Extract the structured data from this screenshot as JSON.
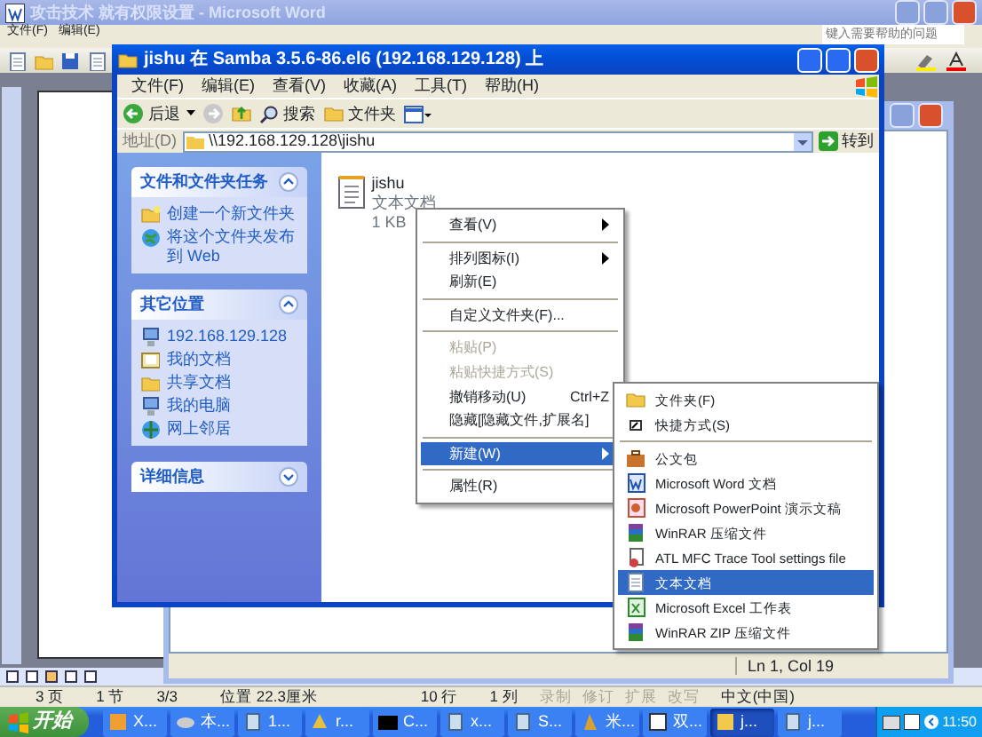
{
  "word": {
    "title": "攻击技术 就有权限设置 - Microsoft Word",
    "menus": [
      "文件(F)",
      "编辑(E)"
    ],
    "help_placeholder": "键入需要帮助的问题",
    "status_bar": [
      "3 页",
      "1 节",
      "3/3",
      "位置 22.3厘米",
      "10 行",
      "1 列"
    ],
    "status_flags": [
      {
        "label": "录制",
        "on": false
      },
      {
        "label": "修订",
        "on": false
      },
      {
        "label": "扩展",
        "on": false
      },
      {
        "label": "改写",
        "on": false
      }
    ],
    "language": "中文(中国)"
  },
  "notepad": {
    "status": "Ln 1, Col 19"
  },
  "explorer": {
    "title": "jishu 在 Samba 3.5.6-86.el6 (192.168.129.128) 上",
    "menus": [
      "文件(F)",
      "编辑(E)",
      "查看(V)",
      "收藏(A)",
      "工具(T)",
      "帮助(H)"
    ],
    "back": "后退",
    "search": "搜索",
    "folders": "文件夹",
    "address_label": "地址(D)",
    "address": "\\\\192.168.129.128\\jishu",
    "go": "转到",
    "panels": [
      {
        "title": "文件和文件夹任务",
        "expanded": true,
        "items": [
          {
            "kind": "new-folder",
            "label": "创建一个新文件夹"
          },
          {
            "kind": "web",
            "label": "将这个文件夹发布到 Web"
          }
        ]
      },
      {
        "title": "其它位置",
        "expanded": true,
        "items": [
          {
            "kind": "computer",
            "label": "192.168.129.128"
          },
          {
            "kind": "documents",
            "label": "我的文档"
          },
          {
            "kind": "folder",
            "label": "共享文档"
          },
          {
            "kind": "computer",
            "label": "我的电脑"
          },
          {
            "kind": "network",
            "label": "网上邻居"
          }
        ]
      },
      {
        "title": "详细信息",
        "expanded": false
      }
    ],
    "file": {
      "name": "jishu",
      "type": "文本文档",
      "size": "1 KB"
    }
  },
  "context_menu": [
    {
      "kind": "item",
      "label": "查看(V)",
      "submenu": true,
      "disabled": false,
      "selected": false
    },
    {
      "kind": "separator"
    },
    {
      "kind": "item",
      "label": "排列图标(I)",
      "submenu": true,
      "disabled": false,
      "selected": false
    },
    {
      "kind": "item",
      "label": "刷新(E)",
      "submenu": false,
      "disabled": false,
      "selected": false
    },
    {
      "kind": "separator"
    },
    {
      "kind": "item",
      "label": "自定义文件夹(F)...",
      "submenu": false,
      "disabled": false,
      "selected": false
    },
    {
      "kind": "separator"
    },
    {
      "kind": "item",
      "label": "粘贴(P)",
      "submenu": false,
      "disabled": true,
      "selected": false
    },
    {
      "kind": "item",
      "label": "粘贴快捷方式(S)",
      "submenu": false,
      "disabled": true,
      "selected": false
    },
    {
      "kind": "item",
      "label": "撤销移动(U)",
      "shortcut": "Ctrl+Z",
      "submenu": false,
      "disabled": false,
      "selected": false
    },
    {
      "kind": "item",
      "label": "隐藏[隐藏文件,扩展名]",
      "submenu": false,
      "disabled": false,
      "selected": false
    },
    {
      "kind": "separator"
    },
    {
      "kind": "item",
      "label": "新建(W)",
      "submenu": true,
      "disabled": false,
      "selected": true
    },
    {
      "kind": "separator"
    },
    {
      "kind": "item",
      "label": "属性(R)",
      "submenu": false,
      "disabled": false,
      "selected": false
    }
  ],
  "new_submenu": [
    {
      "kind": "folder",
      "label": "文件夹(F)",
      "selected": false
    },
    {
      "kind": "shortcut",
      "label": "快捷方式(S)",
      "selected": false
    },
    {
      "kind": "separator"
    },
    {
      "kind": "briefcase",
      "label": "公文包",
      "selected": false
    },
    {
      "kind": "word",
      "label": "Microsoft Word 文档",
      "selected": false
    },
    {
      "kind": "powerpoint",
      "label": "Microsoft PowerPoint 演示文稿",
      "selected": false
    },
    {
      "kind": "archive",
      "label": "WinRAR 压缩文件",
      "selected": false
    },
    {
      "kind": "settings",
      "label": "ATL MFC Trace Tool settings file",
      "selected": false
    },
    {
      "kind": "text",
      "label": "文本文档",
      "selected": true
    },
    {
      "kind": "excel",
      "label": "Microsoft Excel 工作表",
      "selected": false
    },
    {
      "kind": "archive",
      "label": "WinRAR ZIP 压缩文件",
      "selected": false
    }
  ],
  "taskbar": {
    "start": "开始",
    "tasks": [
      {
        "label": "X...",
        "selected": false
      },
      {
        "label": "本...",
        "selected": false
      },
      {
        "label": "1...",
        "selected": false
      },
      {
        "label": "r...",
        "selected": false
      },
      {
        "label": "C...",
        "selected": false
      },
      {
        "label": "x...",
        "selected": false
      },
      {
        "label": "S...",
        "selected": false
      },
      {
        "label": "米...",
        "selected": false
      },
      {
        "label": "双...",
        "selected": false
      },
      {
        "label": "j...",
        "selected": true
      },
      {
        "label": "j...",
        "selected": false
      }
    ],
    "clock": "11:50"
  }
}
